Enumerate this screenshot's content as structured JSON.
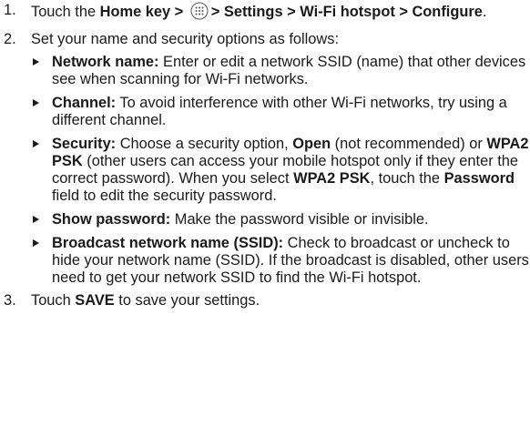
{
  "steps": [
    {
      "number": "1.",
      "parts": [
        {
          "text": "Touch the ",
          "bold": false
        },
        {
          "text": "Home",
          "bold": true
        },
        {
          "text": " key > ",
          "bold": false
        },
        {
          "text": "> Settings > Wi-Fi hotspot > Configure",
          "bold": true
        },
        {
          "text": ".",
          "bold": false
        }
      ],
      "icon": "apps-grid-icon"
    },
    {
      "number": "2.",
      "text": "Set your name and security options as follows:",
      "bullets": [
        {
          "label": "Network name:",
          "text": " Enter or edit a network SSID (name) that other devices see when scanning for Wi-Fi networks."
        },
        {
          "label": "Channel:",
          "text": " To avoid interference with other Wi-Fi networks, try using a different channel."
        },
        {
          "label": "Security:",
          "t1": " Choose a security option, ",
          "b1": "Open",
          "t2": " (not recommended) or ",
          "b2": "WPA2 PSK",
          "t3": " (other users can access your mobile hotspot only if they enter the correct password). When you select ",
          "b3": "WPA2 PSK",
          "t4": ", touch the ",
          "b4": "Password",
          "t5": " field to edit the security password."
        },
        {
          "label": "Show password:",
          "text": " Make the password visible or invisible."
        },
        {
          "label": "Broadcast network name (SSID):",
          "text": " Check to broadcast or uncheck to hide your network name (SSID). If the broadcast is disabled, other users need to get your network SSID to find the Wi-Fi hotspot."
        }
      ]
    },
    {
      "number": "3.",
      "t1": "Touch ",
      "b1": "SAVE",
      "t2": " to save your settings."
    }
  ]
}
